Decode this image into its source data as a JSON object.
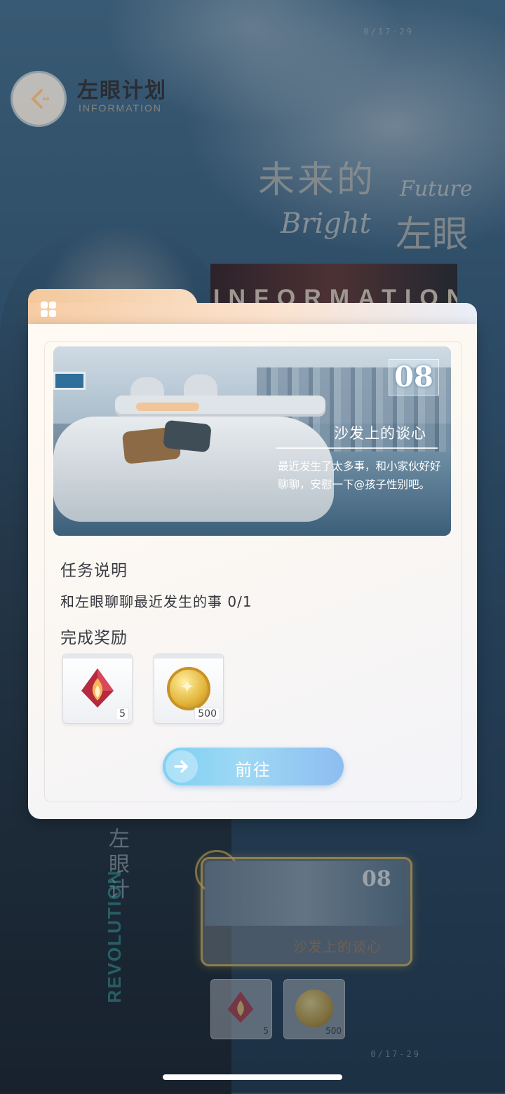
{
  "header": {
    "title": "左眼计划",
    "subtitle": "INFORMATION",
    "back_icon": "chevron-left-icon"
  },
  "background": {
    "top_code": "0/17-29",
    "bottom_code": "0/17-29",
    "hero_cn_line1": "未来的",
    "hero_en_line1": "Future",
    "hero_en_line2": "Bright",
    "hero_cn_line2": "左眼",
    "info_strip": "INFORMATION",
    "jersey_cn": "左眼计",
    "jersey_en": "REVOLUTION"
  },
  "modal": {
    "tab_icon": "four-squares-icon",
    "scene": {
      "number": "08",
      "title": "沙发上的谈心",
      "description": "最近发生了太多事，和小家伙好好聊聊，安慰一下@孩子性别吧。"
    },
    "task_label": "任务说明",
    "task_text": "和左眼聊聊最近发生的事 0/1",
    "reward_label": "完成奖励",
    "rewards": [
      {
        "icon": "flame-crystal-icon",
        "qty": "5"
      },
      {
        "icon": "gold-coin-icon",
        "qty": "500"
      }
    ],
    "go_button": "前往"
  },
  "background_card": {
    "number": "08",
    "title": "沙发上的谈心",
    "rewards": [
      {
        "icon": "flame-crystal-icon",
        "qty": "5"
      },
      {
        "icon": "gold-coin-icon",
        "qty": "500"
      }
    ]
  },
  "colors": {
    "accent_button": "#8fd1f3",
    "modal_tab": "#f3c89b",
    "text_dark": "#33363c"
  }
}
